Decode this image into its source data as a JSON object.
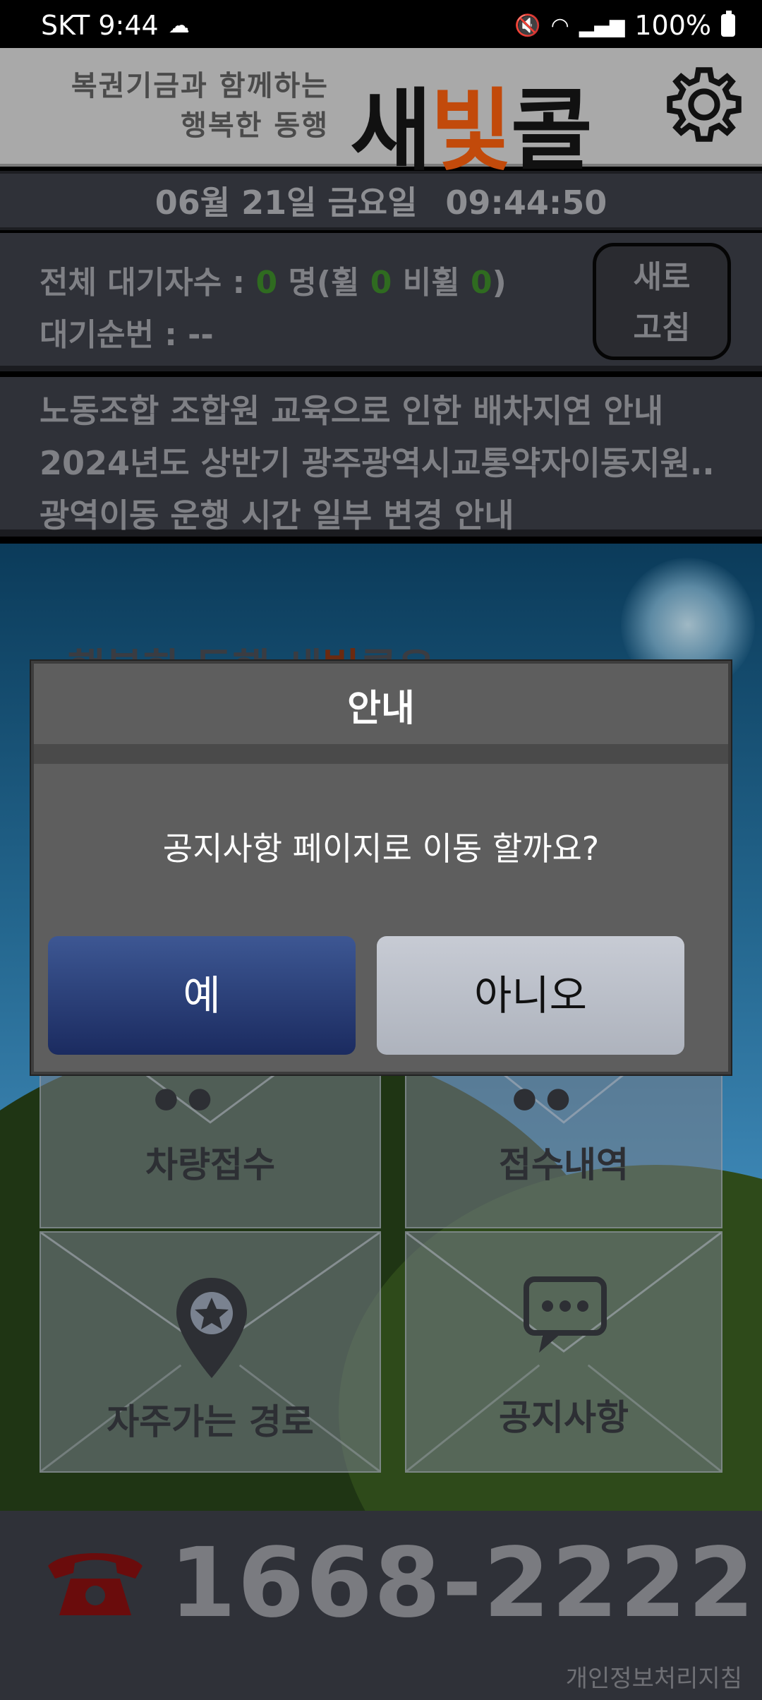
{
  "status_bar": {
    "carrier_time": "SKT 9:44",
    "battery": "100%"
  },
  "header": {
    "slogan_line1": "복권기금과 함께하는",
    "slogan_line2": "행복한 동행",
    "logo_part1": "새",
    "logo_part2": "빛",
    "logo_part3": "콜"
  },
  "datebar": {
    "date": "06월 21일 금요일",
    "time": "09:44:50"
  },
  "wait": {
    "total_label": "전체 대기자수 : ",
    "total_count": "0",
    "unit_open": " 명(휠 ",
    "wheel_count": "0",
    "nonwheel_label": " 비휠 ",
    "nonwheel_count": "0",
    "close": ")",
    "order_label": "대기순번 : --",
    "refresh_line1": "새로",
    "refresh_line2": "고침"
  },
  "notices": [
    "노동조합 조합원 교육으로 인한 배차지연 안내",
    "2024년도 상반기 광주광역시교통약자이동지원..",
    "광역이동 운행 시간 일부 변경 안내"
  ],
  "scene": {
    "title_part1": "행복한 동행 새",
    "title_part2": "빛",
    "title_part3": "콜은"
  },
  "menu": {
    "vehicle_request": "차량접수",
    "request_history": "접수내역",
    "frequent_routes": "자주가는 경로",
    "notices": "공지사항"
  },
  "footer": {
    "phone": "1668-2222",
    "privacy": "개인정보처리지침"
  },
  "dialog": {
    "title": "안내",
    "message": "공지사항 페이지로 이동 할까요?",
    "yes": "예",
    "no": "아니오"
  },
  "colors": {
    "accent_logo": "#c24a0b",
    "count_green": "#2f6b20",
    "yes_button": "#2a3f7a",
    "no_button": "#c0c4cc"
  }
}
